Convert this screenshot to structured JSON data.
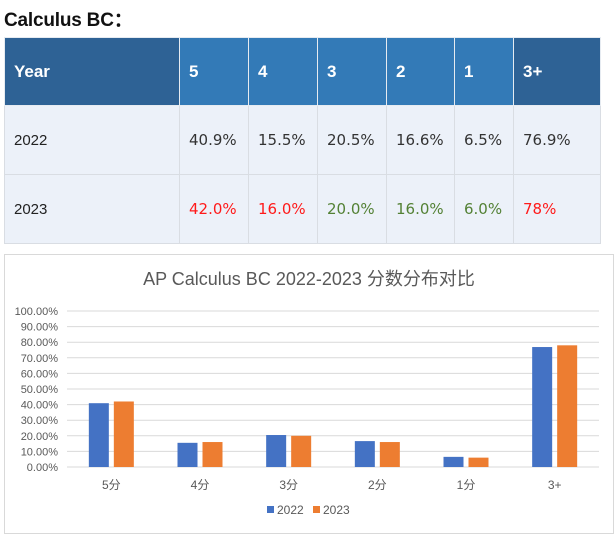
{
  "heading": "Calculus BC：",
  "table": {
    "headers": [
      "Year",
      "5",
      "4",
      "3",
      "2",
      "1",
      "3+"
    ],
    "rows": [
      {
        "year": "2022",
        "cells": [
          {
            "text": "40.9%",
            "tone": "neutral"
          },
          {
            "text": "15.5%",
            "tone": "neutral"
          },
          {
            "text": "20.5%",
            "tone": "neutral"
          },
          {
            "text": "16.6%",
            "tone": "neutral"
          },
          {
            "text": "6.5%",
            "tone": "neutral"
          },
          {
            "text": "76.9%",
            "tone": "neutral"
          }
        ]
      },
      {
        "year": "2023",
        "cells": [
          {
            "text": "42.0%",
            "tone": "up"
          },
          {
            "text": "16.0%",
            "tone": "up"
          },
          {
            "text": "20.0%",
            "tone": "down"
          },
          {
            "text": "16.0%",
            "tone": "down"
          },
          {
            "text": "6.0%",
            "tone": "down"
          },
          {
            "text": "78%",
            "tone": "up"
          }
        ]
      }
    ]
  },
  "colors": {
    "header_blue": "#337ab7",
    "header_dark": "#2e6295",
    "up_red": "#ff1a1a",
    "down_green": "#538135",
    "series_2022": "#4472c4",
    "series_2023": "#ed7d31"
  },
  "chart_data": {
    "type": "bar",
    "title": "AP Calculus BC 2022-2023 分数分布对比",
    "xlabel": "",
    "ylabel": "",
    "categories": [
      "5分",
      "4分",
      "3分",
      "2分",
      "1分",
      "3+"
    ],
    "series": [
      {
        "name": "2022",
        "values": [
          40.9,
          15.5,
          20.5,
          16.6,
          6.5,
          76.9
        ]
      },
      {
        "name": "2023",
        "values": [
          42.0,
          16.0,
          20.0,
          16.0,
          6.0,
          78.0
        ]
      }
    ],
    "ylim": [
      0,
      100
    ],
    "yticks": [
      "0.00%",
      "10.00%",
      "20.00%",
      "30.00%",
      "40.00%",
      "50.00%",
      "60.00%",
      "70.00%",
      "80.00%",
      "90.00%",
      "100.00%"
    ],
    "grid": true,
    "legend": "bottom-center"
  }
}
